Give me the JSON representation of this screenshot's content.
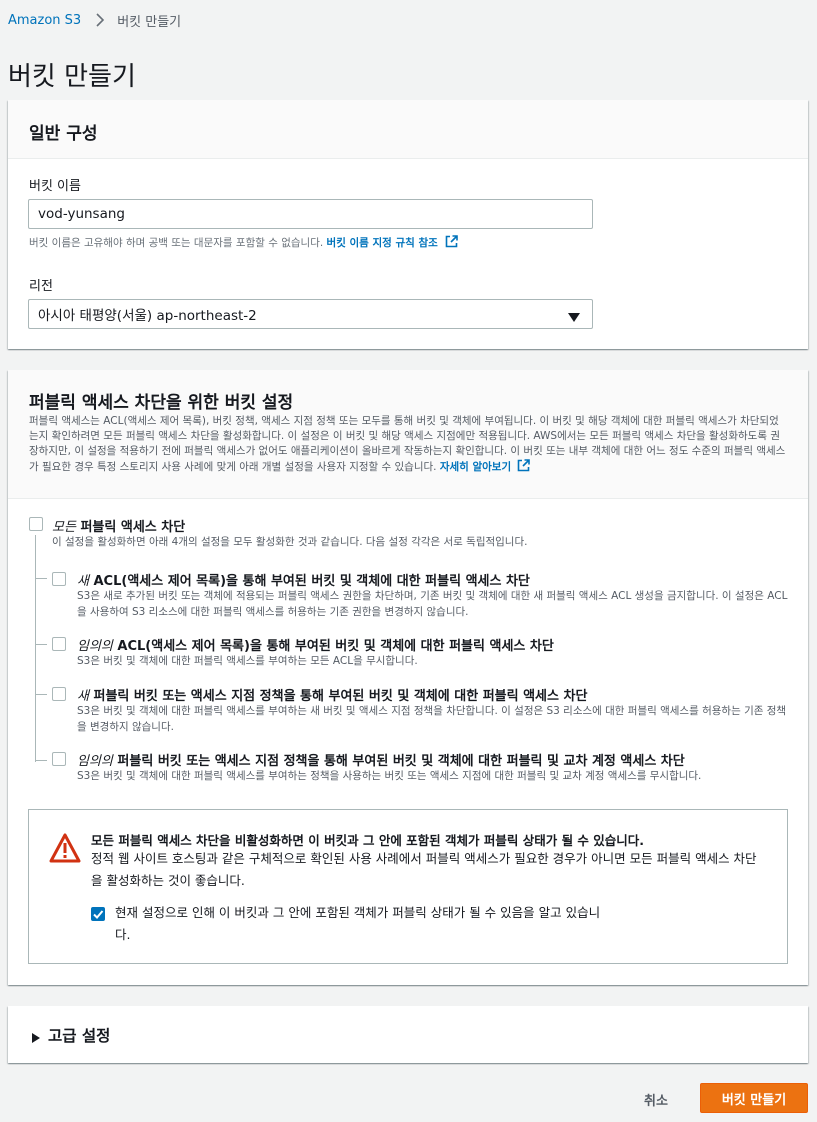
{
  "breadcrumb": {
    "root": "Amazon S3",
    "current": "버킷 만들기"
  },
  "page_title": "버킷 만들기",
  "general": {
    "title": "일반 구성",
    "bucket_name_label": "버킷 이름",
    "bucket_name_value": "vod-yunsang",
    "bucket_name_hint": "버킷 이름은 고유해야 하며 공백 또는 대문자를 포함할 수 없습니다.",
    "bucket_name_hint_link": "버킷 이름 지정 규칙 참조",
    "region_label": "리전",
    "region_value": "아시아 태평양(서울) ap-northeast-2"
  },
  "public_access": {
    "title": "퍼블릭 액세스 차단을 위한 버킷 설정",
    "description": "퍼블릭 액세스는 ACL(액세스 제어 목록), 버킷 정책, 액세스 지점 정책 또는 모두를 통해 버킷 및 객체에 부여됩니다. 이 버킷 및 해당 객체에 대한 퍼블릭 액세스가 차단되었는지 확인하려면 모든 퍼블릭 액세스 차단을 활성화합니다. 이 설정은 이 버킷 및 해당 액세스 지점에만 적용됩니다. AWS에서는 모든 퍼블릭 액세스 차단을 활성화하도록 권장하지만, 이 설정을 적용하기 전에 퍼블릭 액세스가 없어도 애플리케이션이 올바르게 작동하는지 확인합니다. 이 버킷 또는 내부 객체에 대한 어느 정도 수준의 퍼블릭 액세스가 필요한 경우 특정 스토리지 사용 사례에 맞게 아래 개별 설정을 사용자 지정할 수 있습니다.",
    "learn_more": "자세히 알아보기",
    "block_all": {
      "prefix": "모든",
      "title": "퍼블릭 액세스 차단",
      "desc": "이 설정을 활성화하면 아래 4개의 설정을 모두 활성화한 것과 같습니다. 다음 설정 각각은 서로 독립적입니다."
    },
    "options": [
      {
        "prefix": "새",
        "title": "ACL(액세스 제어 목록)을 통해 부여된 버킷 및 객체에 대한 퍼블릭 액세스 차단",
        "desc": "S3은 새로 추가된 버킷 또는 객체에 적용되는 퍼블릭 액세스 권한을 차단하며, 기존 버킷 및 객체에 대한 새 퍼블릭 액세스 ACL 생성을 금지합니다. 이 설정은 ACL을 사용하여 S3 리소스에 대한 퍼블릭 액세스를 허용하는 기존 권한을 변경하지 않습니다."
      },
      {
        "prefix": "임의의",
        "title": "ACL(액세스 제어 목록)을 통해 부여된 버킷 및 객체에 대한 퍼블릭 액세스 차단",
        "desc": "S3은 버킷 및 객체에 대한 퍼블릭 액세스를 부여하는 모든 ACL을 무시합니다."
      },
      {
        "prefix": "새",
        "title": "퍼블릭 버킷 또는 액세스 지점 정책을 통해 부여된 버킷 및 객체에 대한 퍼블릭 액세스 차단",
        "desc": "S3은 버킷 및 객체에 대한 퍼블릭 액세스를 부여하는 새 버킷 및 액세스 지점 정책을 차단합니다. 이 설정은 S3 리소스에 대한 퍼블릭 액세스를 허용하는 기존 정책을 변경하지 않습니다."
      },
      {
        "prefix": "임의의",
        "title": "퍼블릭 버킷 또는 액세스 지점 정책을 통해 부여된 버킷 및 객체에 대한 퍼블릭 및 교차 계정 액세스 차단",
        "desc": "S3은 버킷 및 객체에 대한 퍼블릭 액세스를 부여하는 정책을 사용하는 버킷 또는 액세스 지점에 대한 퍼블릭 및 교차 계정 액세스를 무시합니다."
      }
    ],
    "warning": {
      "title": "모든 퍼블릭 액세스 차단을 비활성화하면 이 버킷과 그 안에 포함된 객체가 퍼블릭 상태가 될 수 있습니다.",
      "text": "정적 웹 사이트 호스팅과 같은 구체적으로 확인된 사용 사례에서 퍼블릭 액세스가 필요한 경우가 아니면 모든 퍼블릭 액세스 차단을 활성화하는 것이 좋습니다.",
      "ack": "현재 설정으로 인해 이 버킷과 그 안에 포함된 객체가 퍼블릭 상태가 될 수 있음을 알고 있습니다."
    }
  },
  "advanced": {
    "title": "고급 설정"
  },
  "actions": {
    "cancel": "취소",
    "create": "버킷 만들기"
  },
  "colors": {
    "accent": "#ec7211",
    "link": "#0073bb",
    "warning": "#d13212"
  }
}
